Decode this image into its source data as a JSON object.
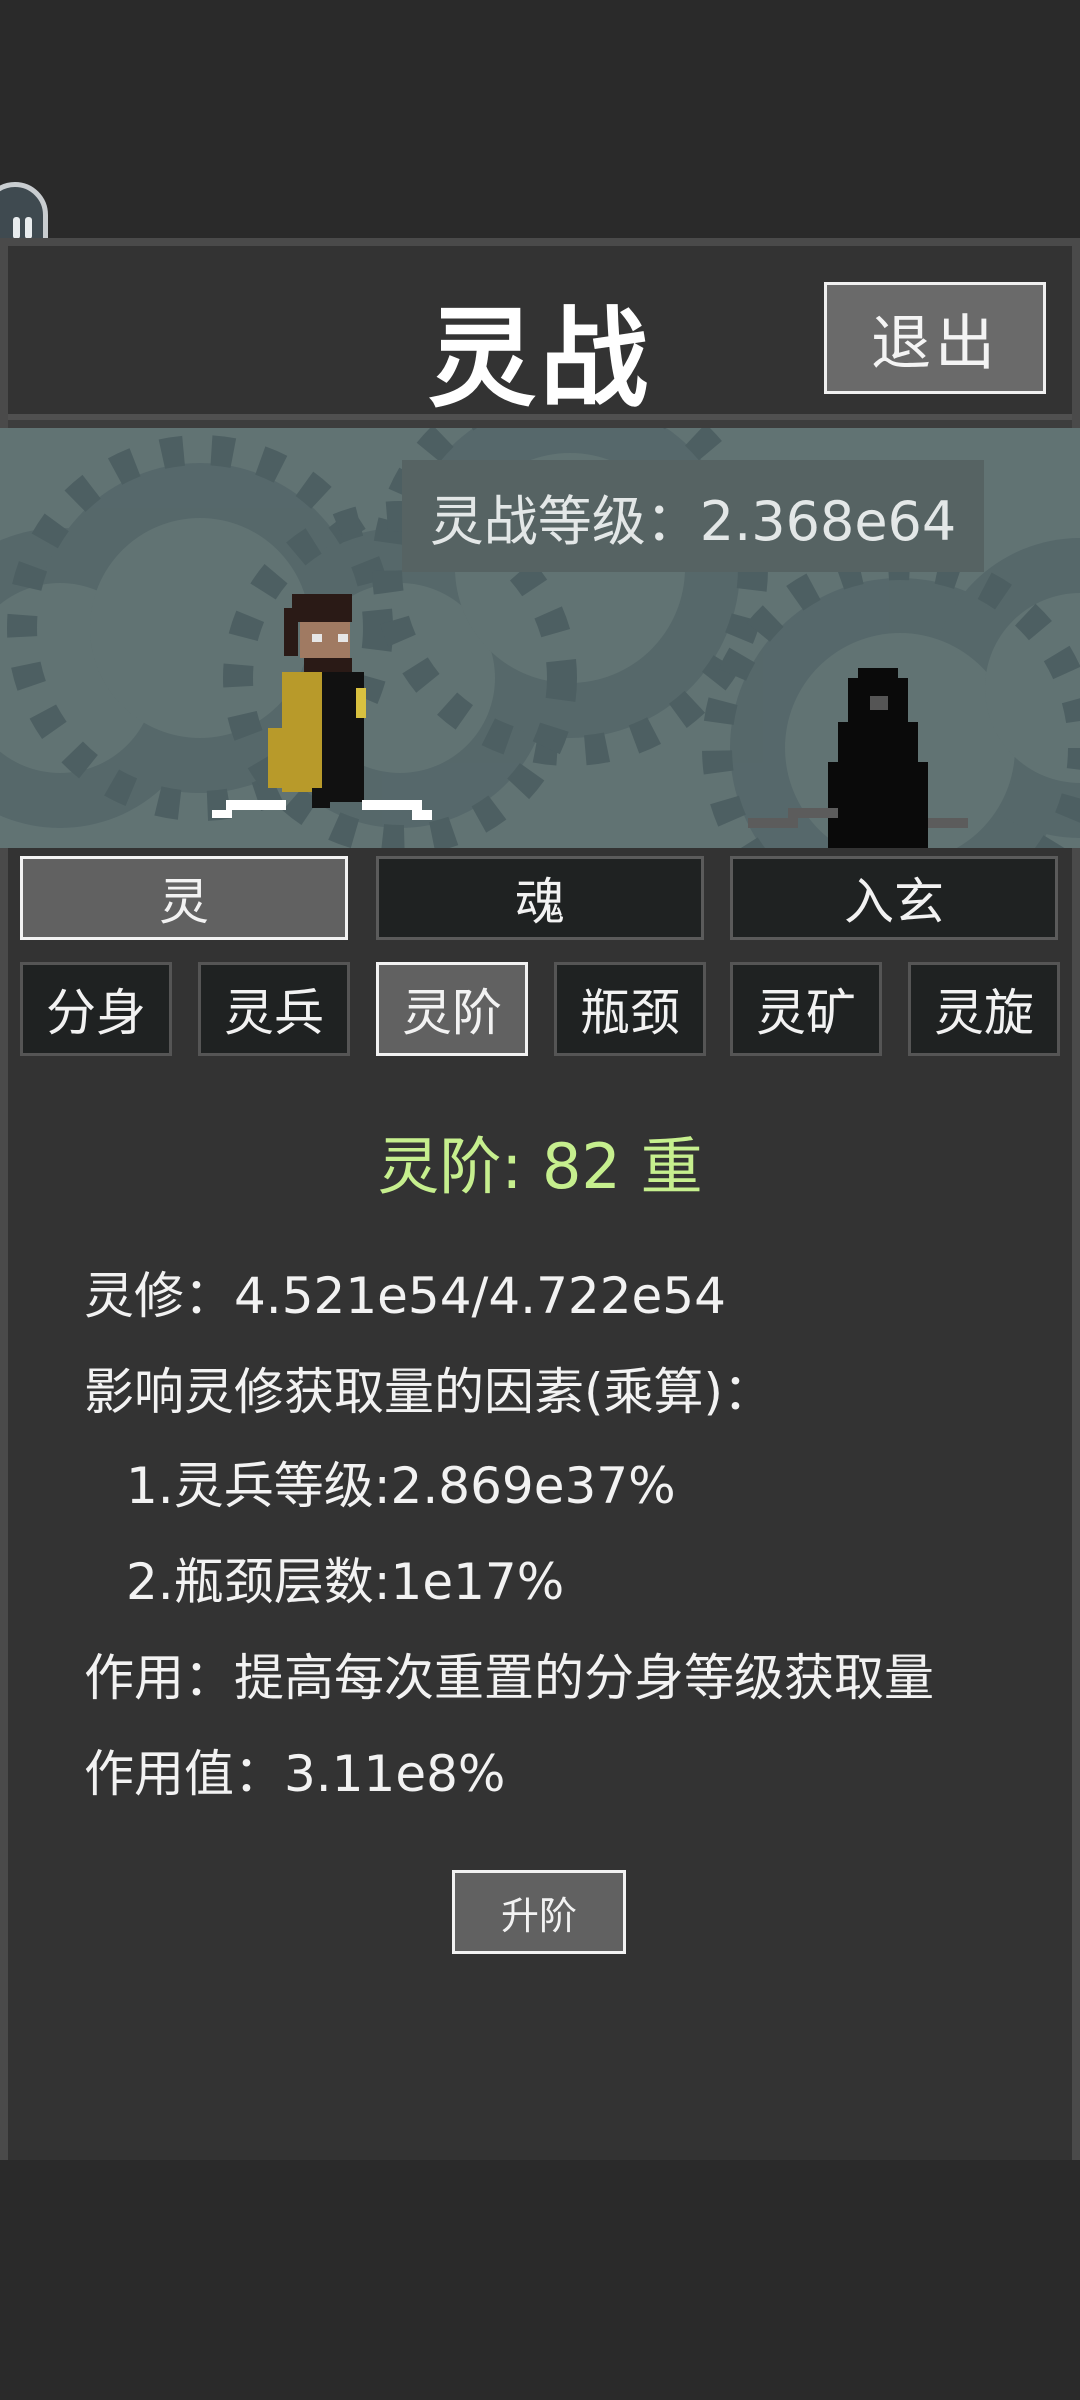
{
  "header": {
    "title": "灵战",
    "exit_label": "退出"
  },
  "scene": {
    "level_text": "灵战等级：2.368e64"
  },
  "main_tabs": [
    {
      "label": "灵",
      "active": true
    },
    {
      "label": "魂",
      "active": false
    },
    {
      "label": "入玄",
      "active": false
    }
  ],
  "sub_tabs": [
    {
      "label": "分身",
      "active": false
    },
    {
      "label": "灵兵",
      "active": false
    },
    {
      "label": "灵阶",
      "active": true
    },
    {
      "label": "瓶颈",
      "active": false
    },
    {
      "label": "灵矿",
      "active": false
    },
    {
      "label": "灵旋",
      "active": false
    }
  ],
  "content": {
    "title": "灵阶: 82 重",
    "lines": [
      "灵修：4.521e54/4.722e54",
      "影响灵修获取量的因素(乘算)：",
      "1.灵兵等级:2.869e37%",
      "2.瓶颈层数:1e17%",
      "作用：提高每次重置的分身等级获取量",
      "作用值：3.11e8%"
    ],
    "button_label": "升阶"
  },
  "colors": {
    "background": "#2a2a2a",
    "panel": "#333333",
    "scene_bg": "#617373",
    "title_green": "#c6ef8e",
    "active_tab": "#616161",
    "inactive_tab": "#1f2222"
  },
  "icons": {
    "floating_button": "pause-icon"
  }
}
